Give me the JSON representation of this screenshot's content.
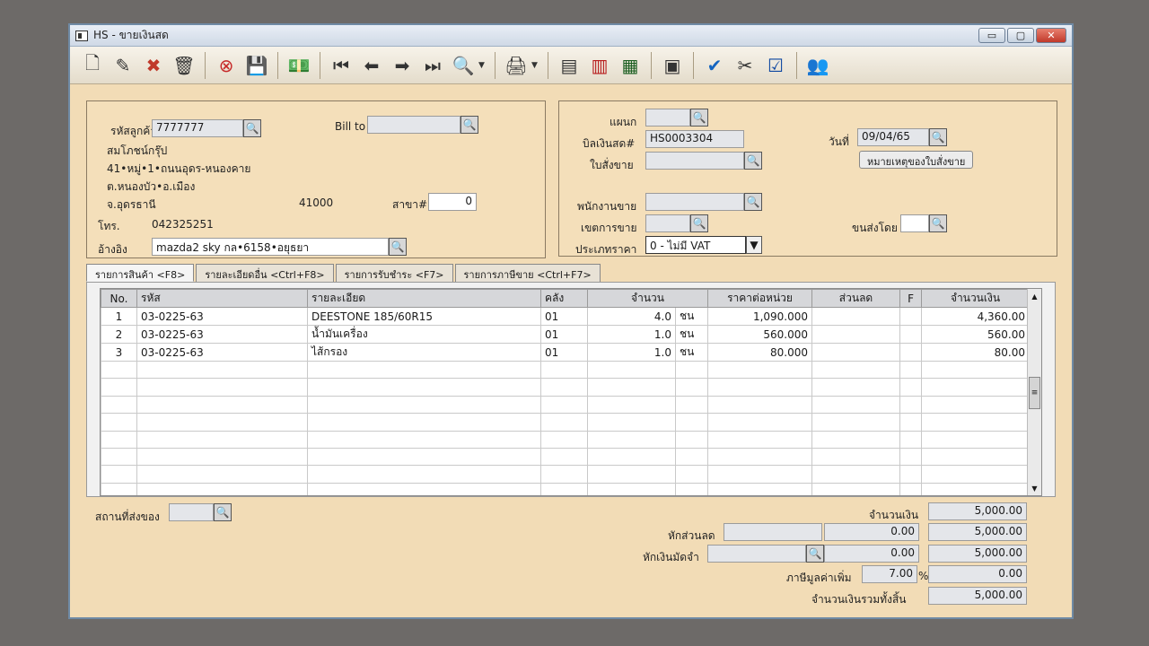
{
  "window": {
    "title": "HS - ขายเงินสด",
    "minimize": "▭",
    "maximize": "▢",
    "close": "✕"
  },
  "toolbar": {
    "icons": [
      "new-document-icon",
      "edit-icon",
      "delete-icon",
      "trash-icon",
      "cancel-icon",
      "save-icon",
      "money-icon",
      "first-record-icon",
      "prev-record-icon",
      "next-record-icon",
      "last-record-icon",
      "search-icon",
      "print-icon",
      "export-icon",
      "import-icon",
      "report-icon",
      "calculator-icon",
      "approve-icon",
      "scissors-icon",
      "ok-icon",
      "users-icon"
    ]
  },
  "customer": {
    "code_label": "รหัสลูกค้า",
    "code_value": "7777777",
    "bill_to_label": "Bill to",
    "bill_to_value": "",
    "name": "สมโภชน์กรุ๊ป",
    "address1": "41•หมู่•1•ถนนอุดร-หนองคาย",
    "address2": "ต.หนองบัว•อ.เมือง",
    "province": "จ.อุดรธานี",
    "postcode": "41000",
    "branch_label": "สาขา#",
    "branch_value": "0",
    "phone_label": "โทร.",
    "phone_value": "042325251",
    "ref_label": "อ้างอิง",
    "ref_value": "mazda2 sky กล•6158•อยุธยา"
  },
  "doc": {
    "dept_label": "แผนก",
    "dept_value": "",
    "bill_label": "บิลเงินสด#",
    "bill_value": "HS0003304",
    "date_label": "วันที่",
    "date_value": "09/04/65",
    "so_label": "ใบสั่งขาย",
    "so_value": "",
    "so_note_button": "หมายเหตุของใบสั่งขาย",
    "salesman_label": "พนักงานขาย",
    "salesman_value": "",
    "zone_label": "เขตการขาย",
    "zone_value": "",
    "ship_by_label": "ขนส่งโดย",
    "ship_by_value": "",
    "price_type_label": "ประเภทราคา",
    "price_type_value": "0 - ไม่มี VAT"
  },
  "tabs": [
    "รายการสินค้า <F8>",
    "รายละเอียดอื่น <Ctrl+F8>",
    "รายการรับชำระ <F7>",
    "รายการภาษีขาย <Ctrl+F7>"
  ],
  "table": {
    "headers": [
      "No.",
      "รหัส",
      "รายละเอียด",
      "คลัง",
      "จำนวน",
      "",
      "ราคาต่อหน่วย",
      "ส่วนลด",
      "F",
      "จำนวนเงิน"
    ],
    "rows": [
      [
        "1",
        "03-0225-63",
        "DEESTONE 185/60R15",
        "01",
        "4.0",
        "ชน",
        "1,090.000",
        "",
        "",
        "4,360.00"
      ],
      [
        "2",
        "03-0225-63",
        "น้ำมันเครื่อง",
        "01",
        "1.0",
        "ชน",
        "560.000",
        "",
        "",
        "560.00"
      ],
      [
        "3",
        "03-0225-63",
        "ไส้กรอง",
        "01",
        "1.0",
        "ชน",
        "80.000",
        "",
        "",
        "80.00"
      ]
    ],
    "empty_rows": 8
  },
  "footer": {
    "ship_place_label": "สถานที่ส่งของ",
    "ship_place_value": "",
    "amount_label": "จำนวนเงิน",
    "amount_value": "5,000.00",
    "discount_label": "หักส่วนลด",
    "discount_code": "",
    "discount_value": "0.00",
    "after_discount": "5,000.00",
    "deposit_label": "หักเงินมัดจำ",
    "deposit_code": "",
    "deposit_value": "0.00",
    "after_deposit": "5,000.00",
    "vat_label": "ภาษีมูลค่าเพิ่ม",
    "vat_rate": "7.00",
    "vat_percent": "%",
    "vat_value": "0.00",
    "total_label": "จำนวนเงินรวมทั้งสิ้น",
    "total_value": "5,000.00"
  }
}
